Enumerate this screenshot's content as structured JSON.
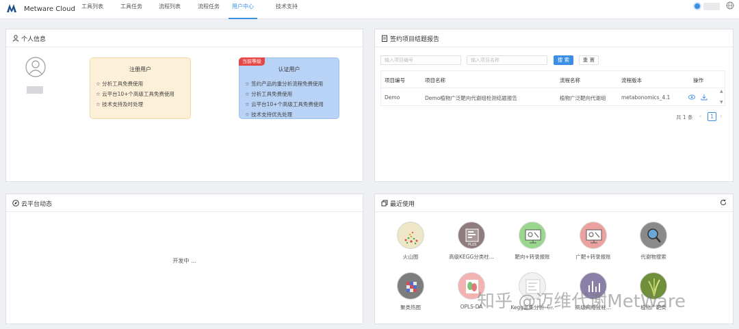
{
  "brand": "Metware Cloud",
  "nav": {
    "items": [
      "工具列表",
      "工具任务",
      "流程列表",
      "流程任务",
      "用户中心",
      "技术支持"
    ],
    "active": "用户中心"
  },
  "personal": {
    "title": "个人信息",
    "registered": {
      "title": "注册用户",
      "items": [
        "☆ 分析工具免费使用",
        "☆ 云平台10+个高级工具免费使用",
        "☆ 技术支持及时处理"
      ]
    },
    "certified": {
      "badge": "当前等级",
      "title": "认证用户",
      "items": [
        "☆ 签约产品的重分析流程免费使用",
        "☆ 分析工具免费使用",
        "☆ 云平台10+个高级工具免费使用",
        "☆ 技术支持优先处理"
      ]
    }
  },
  "contract": {
    "title": "签约项目结题报告",
    "placeholder_code": "输入项目编号",
    "placeholder_name": "输入项目名称",
    "search_label": "搜 索",
    "reset_label": "重 置",
    "columns": [
      "项目编号",
      "项目名称",
      "流程名称",
      "流程版本",
      "操作"
    ],
    "rows": [
      {
        "code": "Demo",
        "name": "Demo植物广泛靶向代谢组检测结题报告",
        "flow": "植物广泛靶向代谢组",
        "version": "metabonomics_4.1"
      }
    ],
    "total": "共 1 条",
    "page": "1"
  },
  "dynamic": {
    "title": "云平台动态",
    "status": "开发中 ..."
  },
  "recent": {
    "title": "最近使用",
    "tools": [
      {
        "label": "火山图",
        "icon": "volcano-plot-icon"
      },
      {
        "label": "高级KEGG分类柱...",
        "icon": "kegg-plus-icon"
      },
      {
        "label": "靶向+转录报账",
        "icon": "target-transcriptome-icon"
      },
      {
        "label": "广靶+转录报账",
        "icon": "widely-target-transcriptome-icon"
      },
      {
        "label": "代谢物搜索",
        "icon": "metabolite-search-icon"
      },
      {
        "label": "聚类热图",
        "icon": "cluster-heatmap-icon"
      },
      {
        "label": "OPLS-DA",
        "icon": "opls-da-icon"
      },
      {
        "label": "Kegg富集分析（...",
        "icon": "kegg-enrichment-icon"
      },
      {
        "label": "高级网络拉柱...",
        "icon": "network-chart-icon"
      },
      {
        "label": "植物广靶类",
        "icon": "plant-widely-target-icon"
      }
    ]
  },
  "watermark": "知乎 @迈维代谢MetWare",
  "colors": {
    "accent": "#3a8ee6",
    "registered_bg": "#fdf0d9",
    "certified_bg": "#b9d3f7",
    "badge": "#e84545"
  }
}
